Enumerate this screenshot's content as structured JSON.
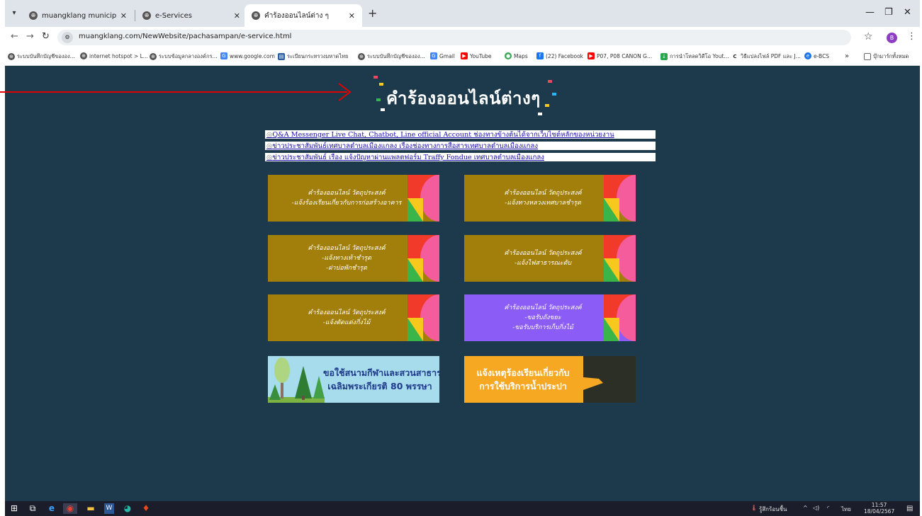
{
  "browser": {
    "tabs": [
      {
        "title": "muangklang municipality.",
        "active": false
      },
      {
        "title": "e-Services",
        "active": false
      },
      {
        "title": "คำร้องออนไลน์ต่าง ๆ",
        "active": true
      }
    ],
    "new_tab": "+",
    "url": "muangklang.com/NewWebsite/pachasampan/e-service.html",
    "profile_initial": "B",
    "bookmarks": [
      "ระบบบันทึกบัญชีขององ...",
      "internet hotspot > L...",
      "ระบบข้อมูลกลางองค์กร...",
      "www.google.com",
      "ระเบียนกระทรวงมหาดไทย",
      "ระบบบันทึกบัญชีขององ...",
      "Gmail",
      "YouTube",
      "Maps",
      "(22) Facebook",
      "P07, P08 CANON G...",
      "การนำโหลดวิดีโอ Yout...",
      "วิธีแปลงไฟล์ PDF และ J...",
      "e-BCS"
    ],
    "bookmarks_more": "»",
    "bookmarks_folder": "บุ๊กมาร์กทั้งหมด"
  },
  "page": {
    "banner_title": "คำร้องออนไลน์ต่างๆ",
    "news_links": [
      "Q&A Messenger Live Chat, Chatbot, Line official Account ช่องทางข้างต้นได้จากเว็บไซต์หลักของหน่วยงาน",
      "ข่าวประชาสัมพันธ์เทศบาลตำบลเมืองแกลง เรื่องช่องทางการสื่อสารเทศบาลตำบลเมืองแกลง",
      "ข่าวประชาสัมพันธ์ เรื่อง แจ้งปัญหาผ่านแพลตฟอร์ม Traffy Fondue เทศบาลตำบลเมืองแกลง"
    ],
    "cards": [
      {
        "lines": [
          "คำร้องออนไลน์ วัตถุประสงค์",
          "-แจ้งร้องเรียนเกี่ยวกับการก่อสร้างอาคาร"
        ],
        "color": "#a27f0b"
      },
      {
        "lines": [
          "คำร้องออนไลน์ วัตถุประสงค์",
          "-แจ้งทางหลวงเทศบาลชำรุด"
        ],
        "color": "#a27f0b"
      },
      {
        "lines": [
          "คำร้องออนไลน์ วัตถุประสงค์",
          "-แจ้งทางเท้าชำรุด",
          "-ฝาบ่อพักชำรุด"
        ],
        "color": "#a27f0b"
      },
      {
        "lines": [
          "คำร้องออนไลน์ วัตถุประสงค์",
          "-แจ้งไฟสาธารณะดับ"
        ],
        "color": "#a27f0b"
      },
      {
        "lines": [
          "คำร้องออนไลน์ วัตถุประสงค์",
          "-แจ้งตัดแต่งกิ่งไม้"
        ],
        "color": "#a27f0b"
      },
      {
        "lines": [
          "คำร้องออนไลน์ วัตถุประสงค์",
          "-ขอรับถังขยะ",
          "-ขอรับบริการเก็บกิ่งไม้"
        ],
        "color": "#8b5cf6"
      }
    ],
    "park_card": {
      "lines": [
        "ขอใช้สนามกีฬาและสวนสาธารณะ",
        "เฉลิมพระเกียรติ 80 พรรษา"
      ]
    },
    "water_card": {
      "lines": [
        "แจ้งเหตุร้องเรียนเกี่ยวกับ",
        "การใช้บริการน้ำประปา"
      ]
    }
  },
  "taskbar": {
    "weather": "รู้สึกร้อนชื้น",
    "lang": "ไทย",
    "time": "11:57",
    "date": "18/04/2567"
  },
  "colors": {
    "page_bg": "#1d3a4c",
    "card_gold": "#a27f0b",
    "card_purple": "#8b5cf6",
    "deco_red": "#f23a2a",
    "deco_pink": "#f45c9c",
    "deco_yellow": "#f7c91c",
    "deco_green": "#3ab54a",
    "park_bg": "#a7dcec",
    "water_bg": "#f7a823",
    "annotation_arrow": "#e00000"
  }
}
